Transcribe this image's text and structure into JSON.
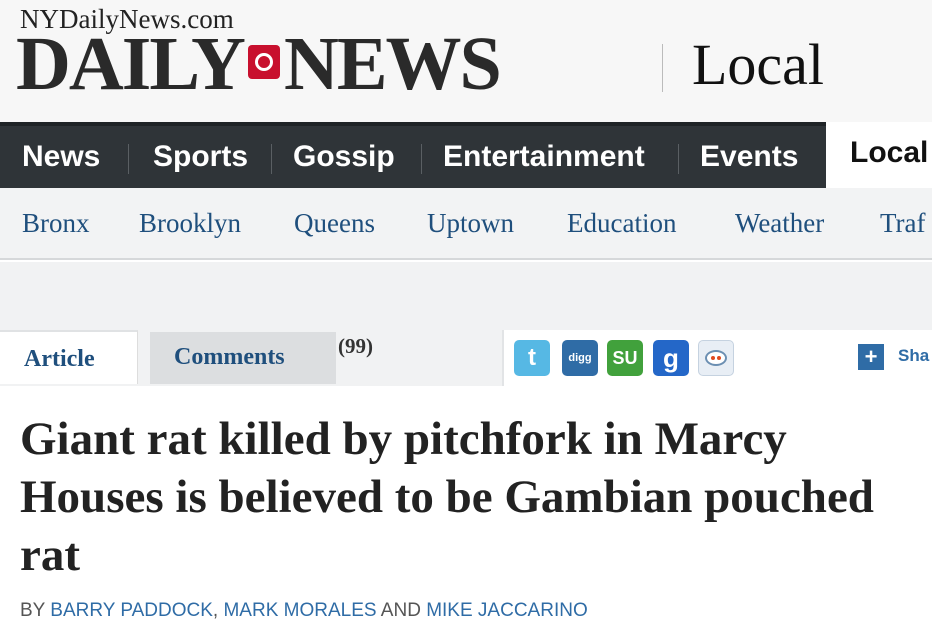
{
  "header": {
    "site_url": "NYDailyNews.com",
    "logo_part1": "DAILY",
    "logo_part2": "NEWS",
    "section": "Local"
  },
  "main_nav": {
    "items": [
      "News",
      "Sports",
      "Gossip",
      "Entertainment",
      "Events"
    ],
    "active": "Local"
  },
  "sub_nav": {
    "items": [
      "Bronx",
      "Brooklyn",
      "Queens",
      "Uptown",
      "Education",
      "Weather",
      "Traf"
    ]
  },
  "tabs": {
    "article": "Article",
    "comments": "Comments",
    "comment_count": "(99)"
  },
  "share": {
    "icons": [
      "twitter-icon",
      "digg-icon",
      "stumbleupon-icon",
      "google-icon",
      "reddit-icon"
    ],
    "twitter_glyph": "t",
    "digg_glyph": "digg",
    "stumble_glyph": "SU",
    "google_glyph": "g",
    "plus_glyph": "+",
    "label": "Sha"
  },
  "article": {
    "headline": "Giant rat killed by pitchfork in Marcy Houses is believed to be Gambian pouched rat",
    "byline_prefix": "BY",
    "authors": [
      "BARRY PADDOCK",
      "MARK MORALES",
      "MIKE JACCARINO"
    ],
    "sep_comma": ",",
    "sep_and": "AND"
  },
  "colors": {
    "nav_bg": "#2f3438",
    "link": "#1f4f7d",
    "brand_red": "#c8102e"
  }
}
